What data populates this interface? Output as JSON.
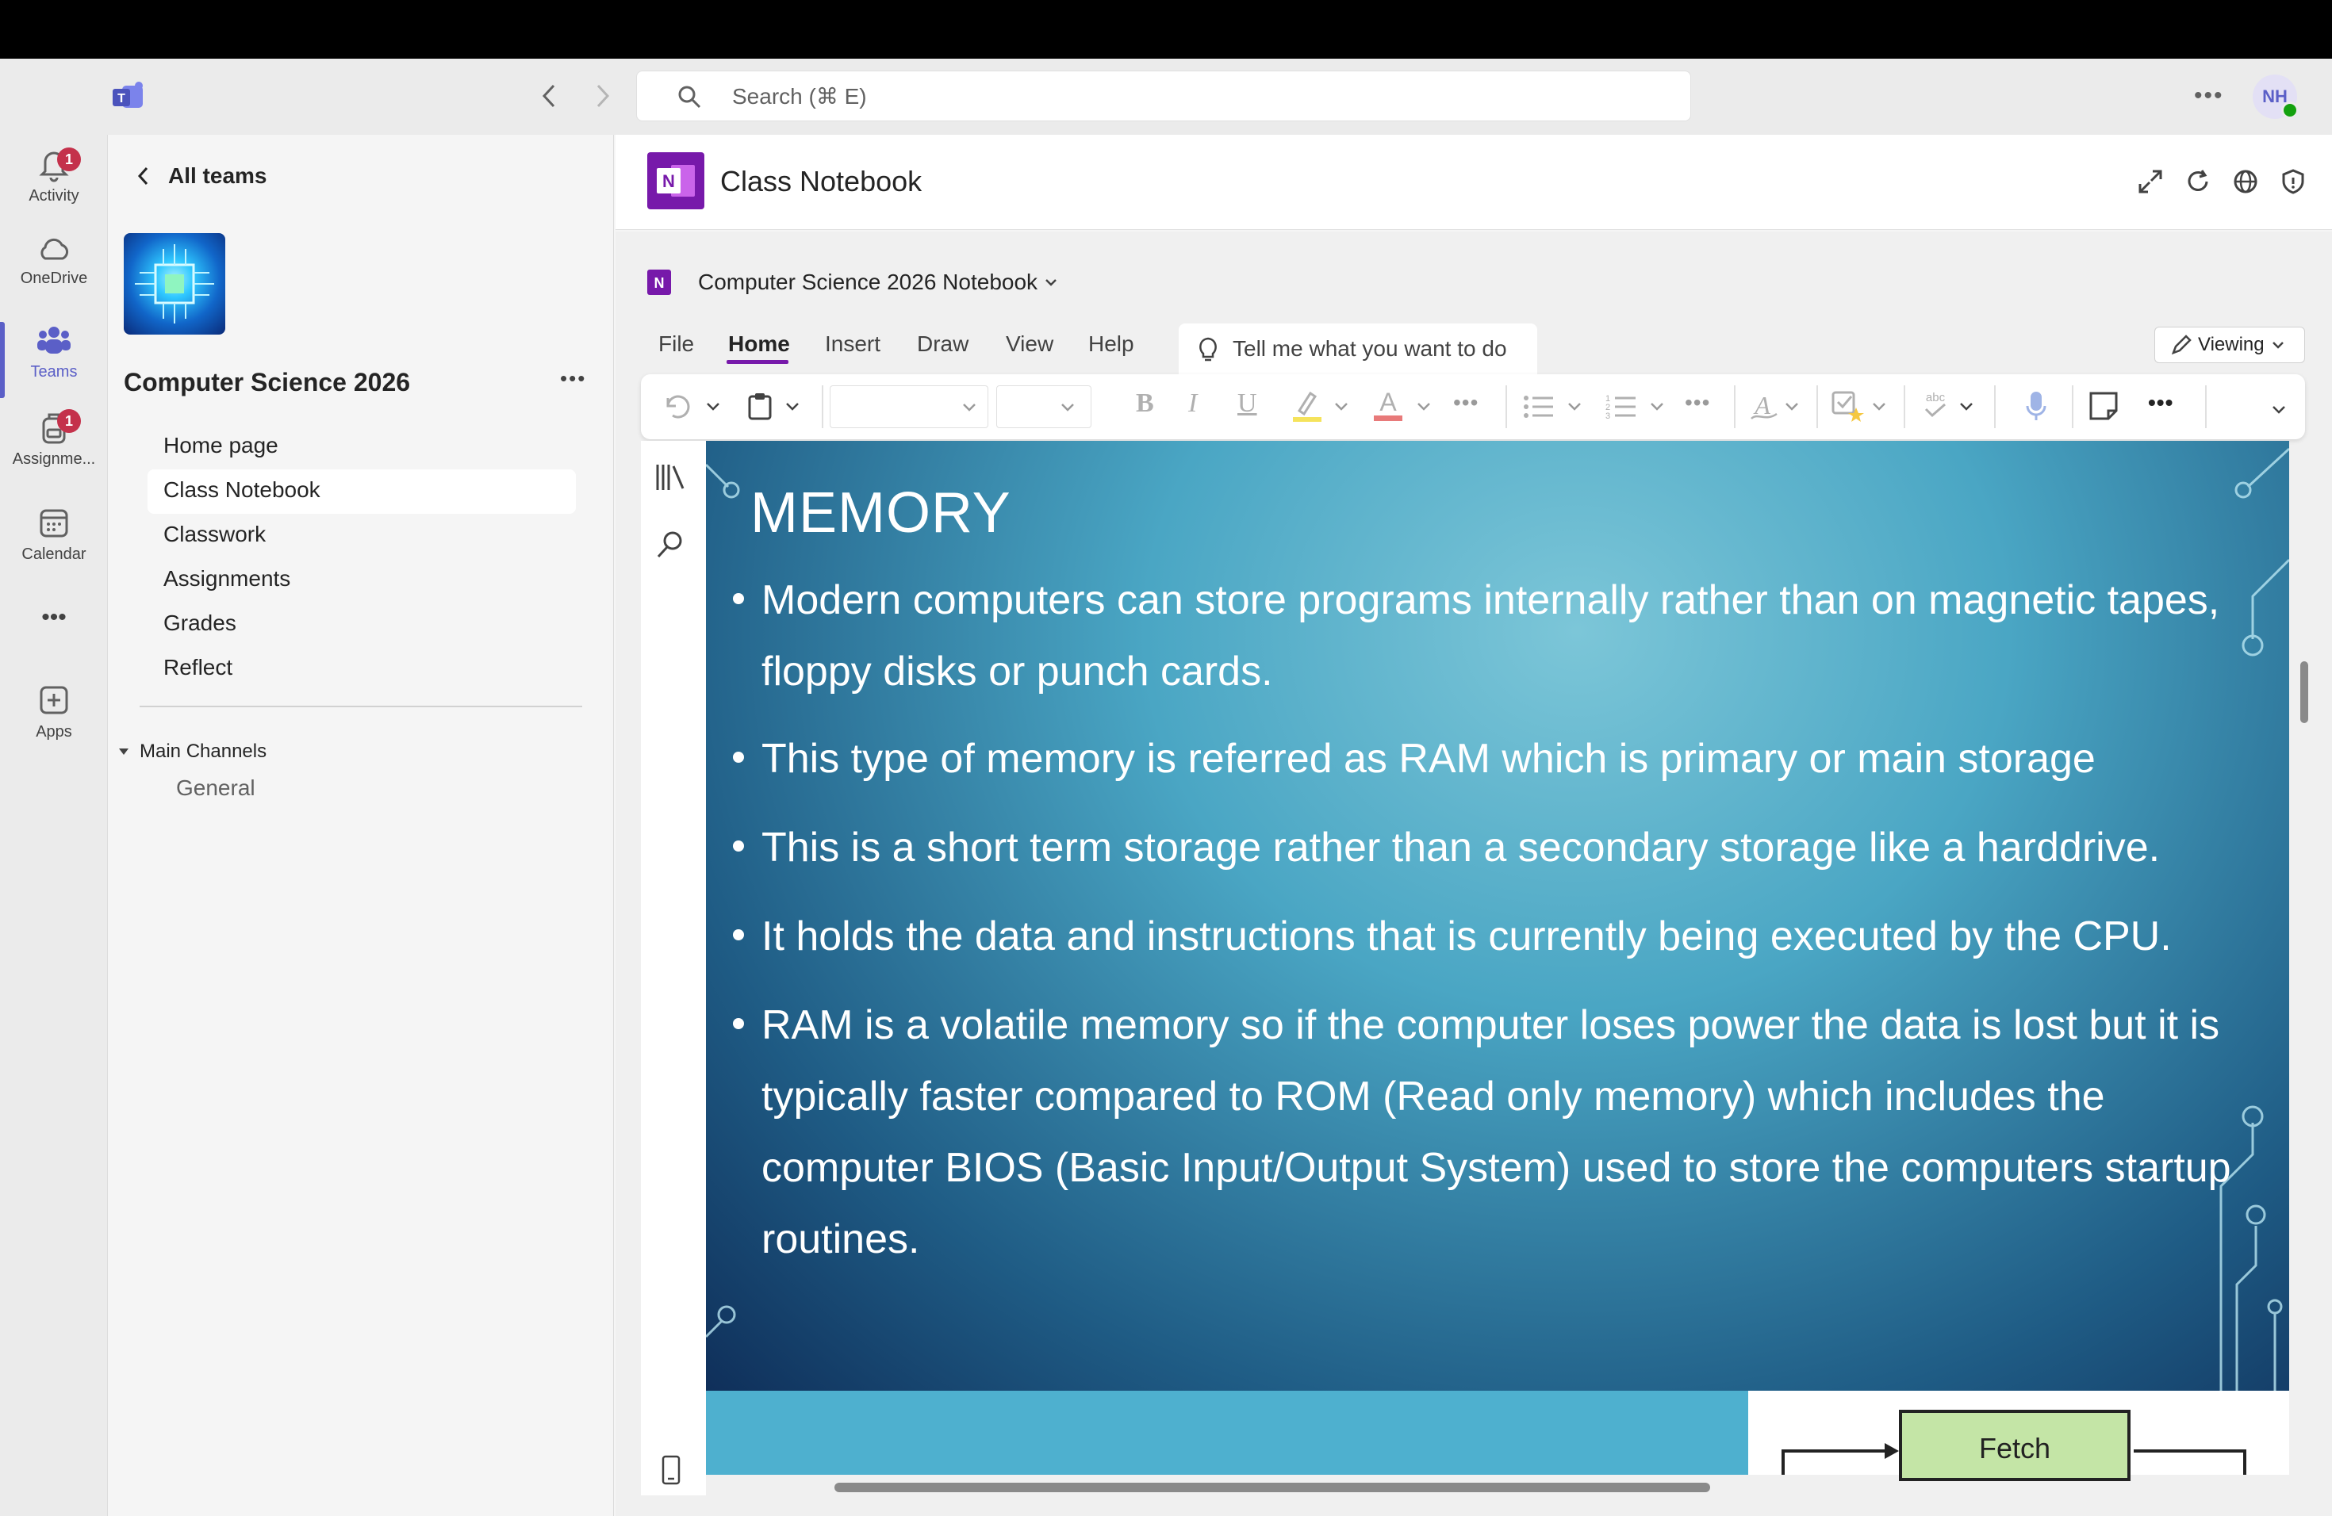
{
  "search": {
    "placeholder": "Search (⌘ E)"
  },
  "user": {
    "initials": "NH"
  },
  "rail": {
    "activity": {
      "label": "Activity",
      "badge": "1"
    },
    "onedrive": {
      "label": "OneDrive"
    },
    "teams": {
      "label": "Teams"
    },
    "assignments": {
      "label": "Assignme...",
      "badge": "1"
    },
    "calendar": {
      "label": "Calendar"
    },
    "more": {
      "label": "•••"
    },
    "apps": {
      "label": "Apps"
    }
  },
  "team": {
    "back_label": "All teams",
    "name": "Computer Science 2026",
    "nav": [
      "Home page",
      "Class Notebook",
      "Classwork",
      "Assignments",
      "Grades",
      "Reflect"
    ],
    "selected": "Class Notebook",
    "channels_header": "Main Channels",
    "channels": [
      "General"
    ]
  },
  "app": {
    "title": "Class Notebook"
  },
  "onenote": {
    "notebook": "Computer Science 2026 Notebook",
    "menus": [
      "File",
      "Home",
      "Insert",
      "Draw",
      "View",
      "Help"
    ],
    "active_menu": "Home",
    "tellme": "Tell me what you want to do",
    "mode": "Viewing"
  },
  "slide": {
    "title": "MEMORY",
    "bullets": [
      "Modern computers can store programs internally rather than on magnetic tapes, floppy disks or punch cards.",
      "This type of memory is referred as RAM which is primary or main storage",
      "This is a short term storage rather than a secondary storage like a harddrive.",
      "It holds the data and instructions that is currently being executed by the CPU.",
      "RAM is a volatile memory so if the computer loses power the data is lost but it is typically faster compared to ROM (Read only memory) which includes the computer BIOS (Basic Input/Output System) used to store the computers startup routines."
    ]
  },
  "diagram": {
    "fetch": "Fetch"
  },
  "colors": {
    "teams_accent": "#5b5fc7",
    "onenote_purple": "#7719aa",
    "badge": "#c4314b"
  }
}
